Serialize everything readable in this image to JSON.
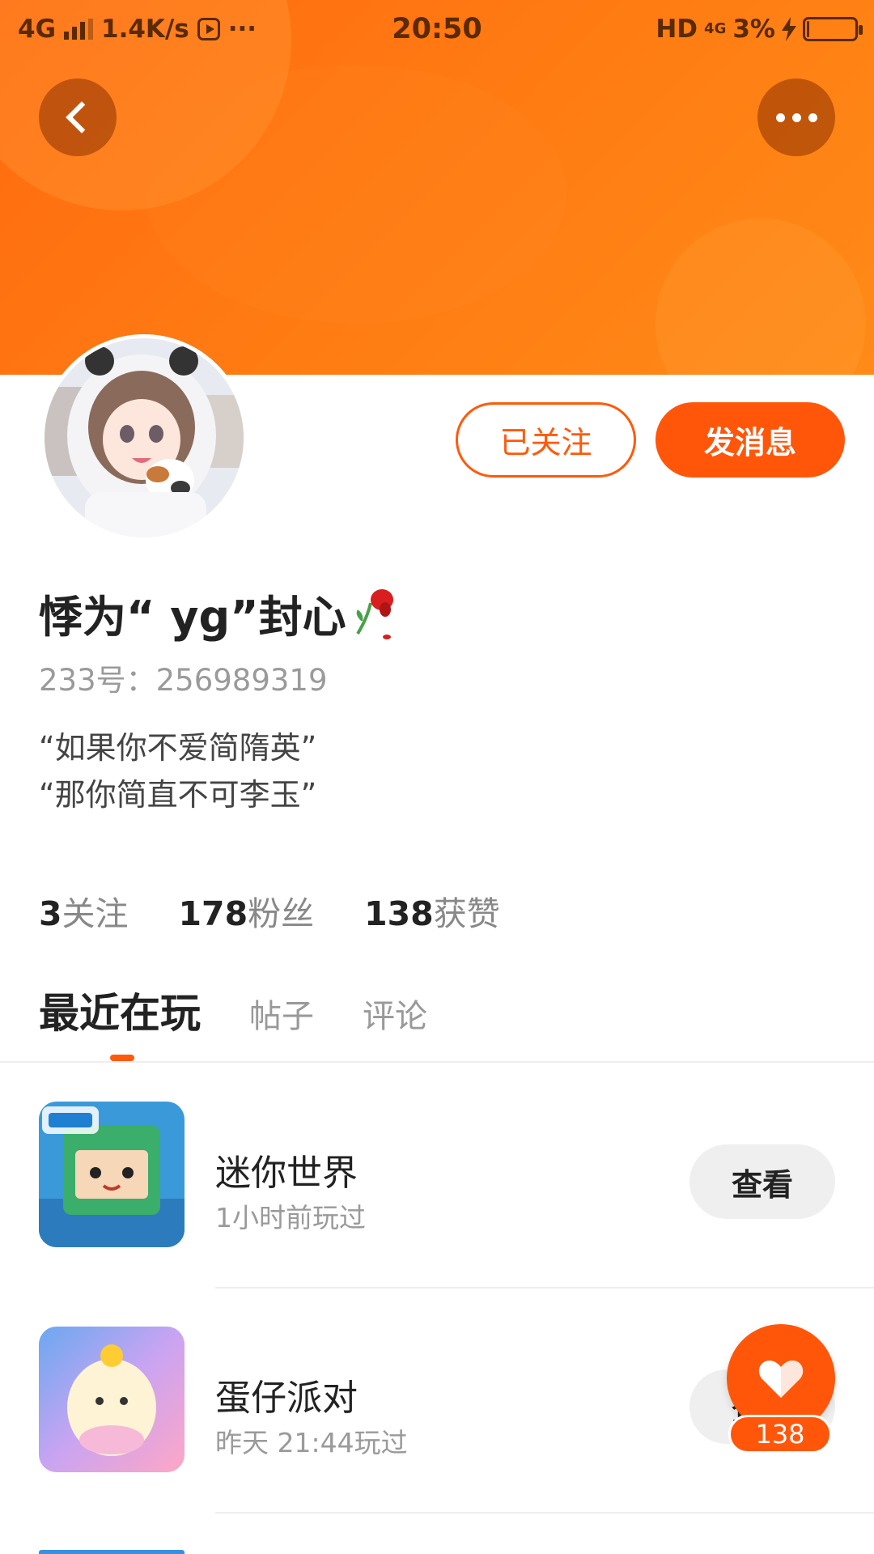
{
  "status_bar": {
    "network": "4G",
    "speed": "1.4K/s",
    "more": "···",
    "time": "20:50",
    "hd": "HD",
    "net_small": "4G",
    "battery": "3%",
    "battery_level": 0.03
  },
  "header": {
    "back_icon": "chevron-left-icon",
    "more_icon": "more-dots-icon",
    "accent": "#ff560a"
  },
  "profile": {
    "follow_label": "已关注",
    "message_label": "发消息",
    "username": "悸为“ yg”封心",
    "uid": "233号：256989319",
    "bio_line1": "“如果你不爱简隋英”",
    "bio_line2": "“那你简直不可李玉”"
  },
  "stats": [
    {
      "num": "3",
      "label": "关注"
    },
    {
      "num": "178",
      "label": "粉丝"
    },
    {
      "num": "138",
      "label": "获赞"
    }
  ],
  "tabs": [
    {
      "label": "最近在玩"
    },
    {
      "label": "帖子"
    },
    {
      "label": "评论"
    }
  ],
  "games": [
    {
      "name": "迷你世界",
      "time": "1小时前玩过",
      "button": "查看"
    },
    {
      "name": "蛋仔派对",
      "time": "昨天 21:44玩过",
      "button": "查看"
    }
  ],
  "like": {
    "count": "138",
    "icon": "heart-icon"
  }
}
